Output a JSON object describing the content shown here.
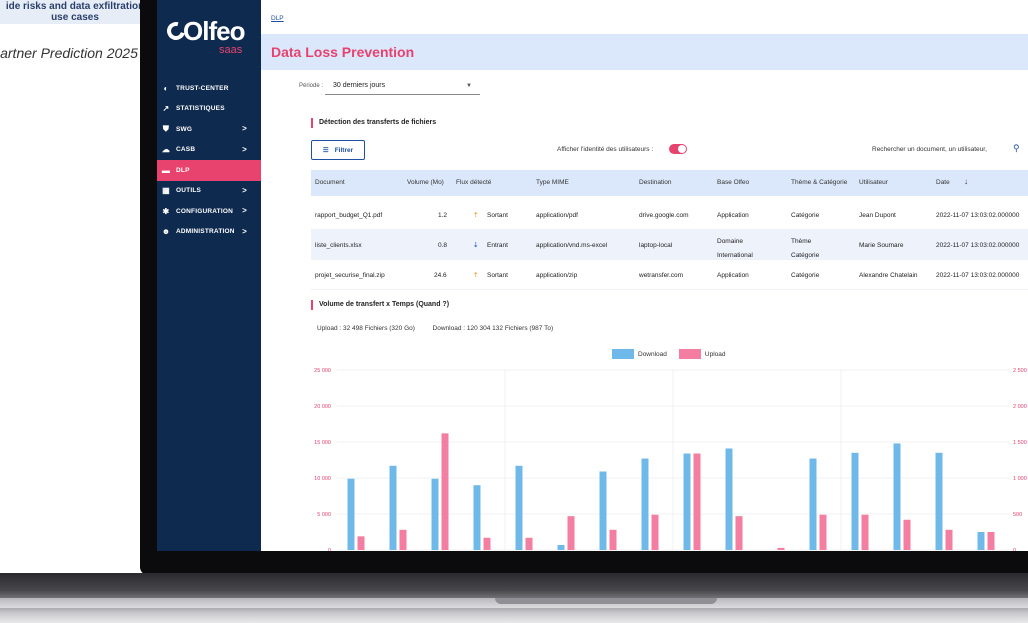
{
  "marketing": {
    "top_text": "ide risks and data exfiltration use cases",
    "caption": "artner Prediction 2025"
  },
  "logo": {
    "name": "Olfeo",
    "suffix": "saas"
  },
  "sidebar": {
    "items": [
      {
        "label": "TRUST-CENTER",
        "icon": "trust-center-icon",
        "chevron": false
      },
      {
        "label": "STATISTIQUES",
        "icon": "statistics-icon",
        "chevron": false
      },
      {
        "label": "SWG",
        "icon": "shield-icon",
        "chevron": true
      },
      {
        "label": "CASB",
        "icon": "cloud-icon",
        "chevron": true
      },
      {
        "label": "DLP",
        "icon": "folder-icon",
        "chevron": false,
        "active": true
      },
      {
        "label": "OUTILS",
        "icon": "tools-icon",
        "chevron": true
      },
      {
        "label": "CONFIGURATION",
        "icon": "gear-icon",
        "chevron": true
      },
      {
        "label": "ADMINISTRATION",
        "icon": "users-icon",
        "chevron": true
      }
    ],
    "chevron": ">"
  },
  "breadcrumb": "DLP",
  "page_title": "Data Loss Prevention",
  "periode": {
    "label": "Période :",
    "value": "30 derniers jours"
  },
  "transfers": {
    "title": "Détection des transferts de fichiers",
    "filter_label": "Filtrer",
    "toggle_label": "Afficher l'identité des utilisateurs :",
    "toggle_on": true,
    "search_placeholder": "Rechercher un document, un utilisateur,",
    "columns": [
      "Document",
      "Volume (Mo)",
      "Flux détecté",
      "Type MIME",
      "Destination",
      "Base Olfeo",
      "Thème & Catégorie",
      "Utilisateur",
      "Date"
    ],
    "rows": [
      {
        "document": "rapport_budget_Q1.pdf",
        "volume": "1.2",
        "flux": "Sortant",
        "flux_icon": "upload-icon",
        "mime": "application/pdf",
        "destination": "drive.google.com",
        "base": "Application",
        "theme": "Catégorie",
        "user": "Jean Dupont",
        "date": "2022-11-07 13:03:02.000000"
      },
      {
        "document": "liste_clients.xlsx",
        "volume": "0.8",
        "flux": "Entrant",
        "flux_icon": "download-icon",
        "mime": "application/vnd.ms-excel",
        "destination": "laptop-local",
        "base": "Domaine International",
        "theme": "Thème Catégorie",
        "user": "Marie Soumare",
        "date": "2022-11-07 13:03:02.000000"
      },
      {
        "document": "projet_securise_final.zip",
        "volume": "24.6",
        "flux": "Sortant",
        "flux_icon": "upload-icon",
        "mime": "application/zip",
        "destination": "wetransfer.com",
        "base": "Application",
        "theme": "Catégorie",
        "user": "Alexandre Chatelain",
        "date": "2022-11-07 13:03:02.000000"
      }
    ]
  },
  "volume_section": {
    "title": "Volume de transfert x Temps (Quand ?)",
    "upload_summary": "Upload : 32 498 Fichiers (320 Go)",
    "download_summary": "Download : 120 304 132 Fichiers (987 To)"
  },
  "colors": {
    "download": "#6fb9ea",
    "upload": "#f37ea1",
    "accent": "#e8426e",
    "sidebar": "#0f2a4f"
  },
  "chart_data": {
    "type": "bar",
    "series": [
      {
        "name": "Download",
        "values": [
          9900,
          11700,
          9900,
          9000,
          11700,
          700,
          10900,
          12700,
          13400,
          14100,
          0,
          12700,
          13500,
          14800,
          13500,
          2500
        ]
      },
      {
        "name": "Upload",
        "values": [
          1900,
          2800,
          16200,
          1700,
          1700,
          4700,
          2800,
          4900,
          13400,
          4700,
          300,
          4900,
          4900,
          4200,
          2800,
          2500
        ]
      }
    ],
    "ylim": [
      0,
      25000
    ],
    "yticks": [
      "0",
      "5 000",
      "10 000",
      "15 000",
      "20 000",
      "25 000"
    ],
    "y2ticks": [
      "0",
      "500",
      "1 000",
      "1 500",
      "2 000",
      "2 500"
    ],
    "legend": "top-center",
    "grid": true
  }
}
